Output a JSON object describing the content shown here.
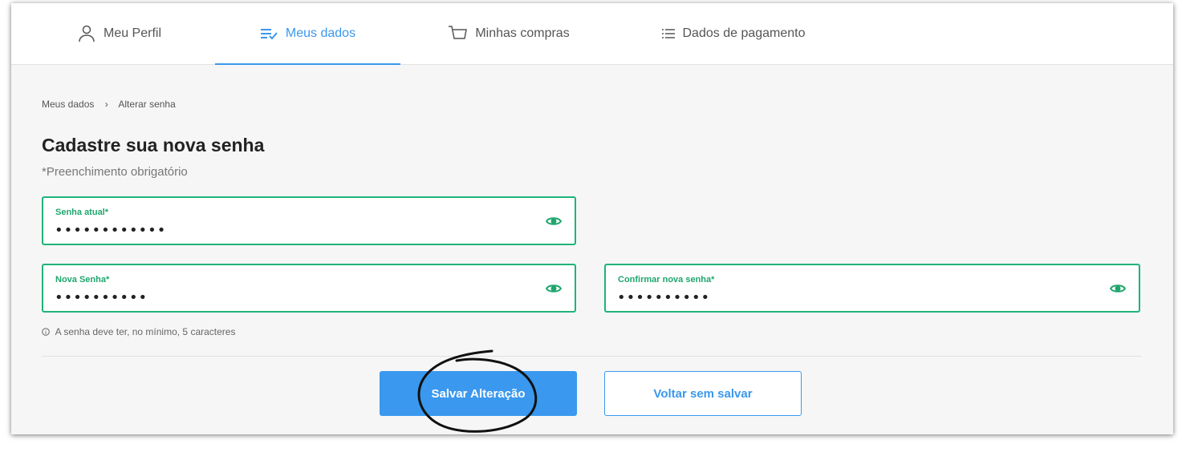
{
  "tabs": [
    {
      "label": "Meu Perfil",
      "icon": "person-icon"
    },
    {
      "label": "Meus dados",
      "icon": "list-check-icon",
      "active": true
    },
    {
      "label": "Minhas compras",
      "icon": "cart-icon"
    },
    {
      "label": "Dados de pagamento",
      "icon": "list-icon"
    }
  ],
  "breadcrumb": {
    "parent": "Meus dados",
    "separator": "›",
    "current": "Alterar senha"
  },
  "page": {
    "title": "Cadastre sua nova senha",
    "subtitle": "*Preenchimento obrigatório"
  },
  "fields": {
    "current_password": {
      "label": "Senha atual*",
      "value": "••••••••••••"
    },
    "new_password": {
      "label": "Nova Senha*",
      "value": "••••••••••"
    },
    "confirm_password": {
      "label": "Confirmar nova senha*",
      "value": "••••••••••"
    }
  },
  "hint": {
    "icon": "info-icon",
    "text": "A senha deve ter, no mínimo, 5 caracteres"
  },
  "buttons": {
    "save": "Salvar Alteração",
    "back": "Voltar sem salvar"
  },
  "colors": {
    "accent": "#3a98ee",
    "success": "#1fb37a"
  }
}
